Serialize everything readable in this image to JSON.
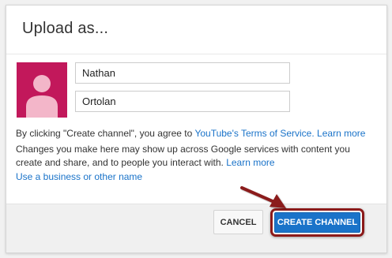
{
  "dialog": {
    "title": "Upload as..."
  },
  "form": {
    "first_name": "Nathan",
    "last_name": "Ortolan"
  },
  "info": {
    "line1_prefix": "By clicking \"Create channel\", you agree to ",
    "tos_link": "YouTube's Terms of Service.",
    "learn_more_1": "Learn more",
    "line2": "Changes you make here may show up across Google services with content you",
    "line3_prefix": "create and share, and to people you interact with.",
    "learn_more_2": "Learn more",
    "business_link": "Use a business or other name"
  },
  "footer": {
    "cancel_label": "CANCEL",
    "create_label": "CREATE CHANNEL"
  },
  "colors": {
    "avatar_bg": "#c2185b",
    "primary": "#1a73c9",
    "annotation": "#8b1a1a"
  },
  "icons": {
    "avatar": "person-silhouette-icon",
    "arrow": "annotation-arrow-icon"
  }
}
